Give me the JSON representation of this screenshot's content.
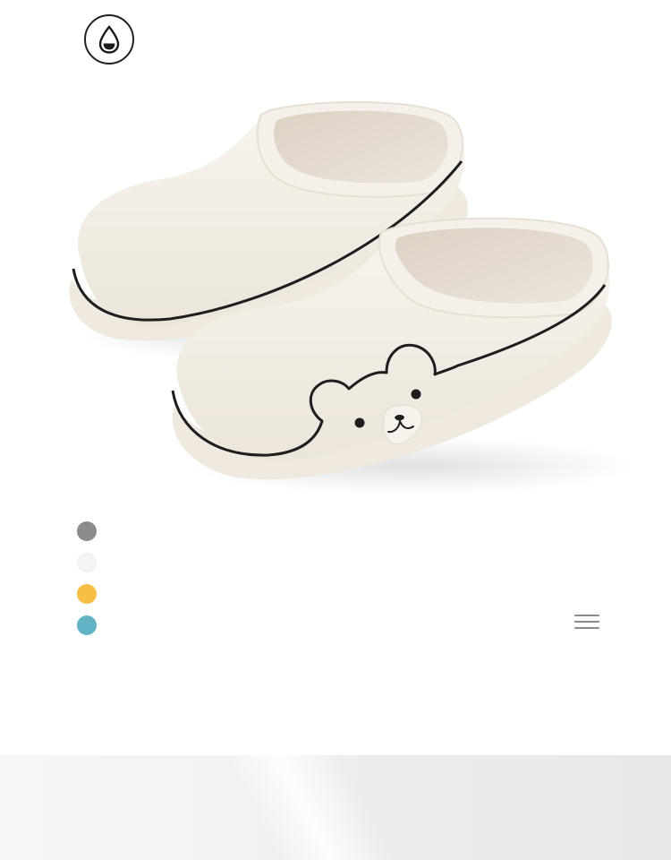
{
  "page": {
    "badge_icon": "water-drop-icon",
    "product_image": "bear-slippers-cream",
    "menu_icon": "hamburger-menu-icon"
  },
  "swatches": [
    {
      "name": "gray",
      "color": "#8c8c8c"
    },
    {
      "name": "white",
      "color": "#f6f3f6"
    },
    {
      "name": "yellow",
      "color": "#f7c045"
    },
    {
      "name": "teal",
      "color": "#62b3c4"
    }
  ],
  "colors": {
    "slipper_body": "#f2ede4",
    "fleece": "#e3dacd",
    "outline": "#1e1e1e",
    "bottom_band": "#ececec"
  }
}
